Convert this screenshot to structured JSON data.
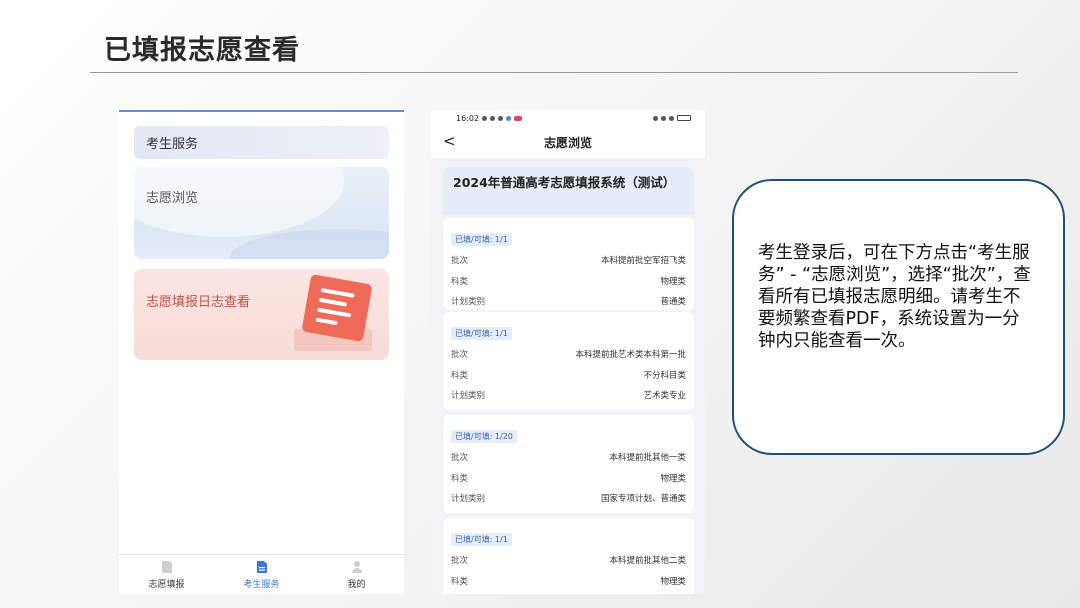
{
  "slide": {
    "title": "已填报志愿查看"
  },
  "left_screen": {
    "header_card": "考生服务",
    "browse_card": "志愿浏览",
    "log_card": "志愿填报日志查看",
    "tabs": [
      {
        "label": "志愿填报"
      },
      {
        "label": "考生服务"
      },
      {
        "label": "我的"
      }
    ],
    "colors": {
      "accent": "#3a79d9",
      "log_text": "#c0504a"
    }
  },
  "mid_screen": {
    "time": "16:02",
    "nav_title": "志愿浏览",
    "back_glyph": "<",
    "system_title": "2024年普通高考志愿填报系统（测试）",
    "entries": [
      {
        "badge": "已填/可填: 1/1",
        "rows": [
          {
            "label": "批次",
            "value": "本科提前批空军招飞类"
          },
          {
            "label": "科类",
            "value": "物理类"
          },
          {
            "label": "计划类别",
            "value": "普通类"
          }
        ]
      },
      {
        "badge": "已填/可填: 1/1",
        "rows": [
          {
            "label": "批次",
            "value": "本科提前批艺术类本科第一批"
          },
          {
            "label": "科类",
            "value": "不分科目类"
          },
          {
            "label": "计划类别",
            "value": "艺术类专业"
          }
        ]
      },
      {
        "badge": "已填/可填: 1/20",
        "rows": [
          {
            "label": "批次",
            "value": "本科提前批其他一类"
          },
          {
            "label": "科类",
            "value": "物理类"
          },
          {
            "label": "计划类别",
            "value": "国家专项计划、普通类"
          }
        ]
      },
      {
        "badge": "已填/可填: 1/1",
        "rows": [
          {
            "label": "批次",
            "value": "本科提前批其他二类"
          },
          {
            "label": "科类",
            "value": "物理类"
          }
        ]
      }
    ]
  },
  "callout": {
    "text": "考生登录后，可在下方点击“考生服务” - “志愿浏览”，选择“批次”，查看所有已填报志愿明细。请考生不要频繁查看PDF，系统设置为一分钟内只能查看一次。"
  }
}
